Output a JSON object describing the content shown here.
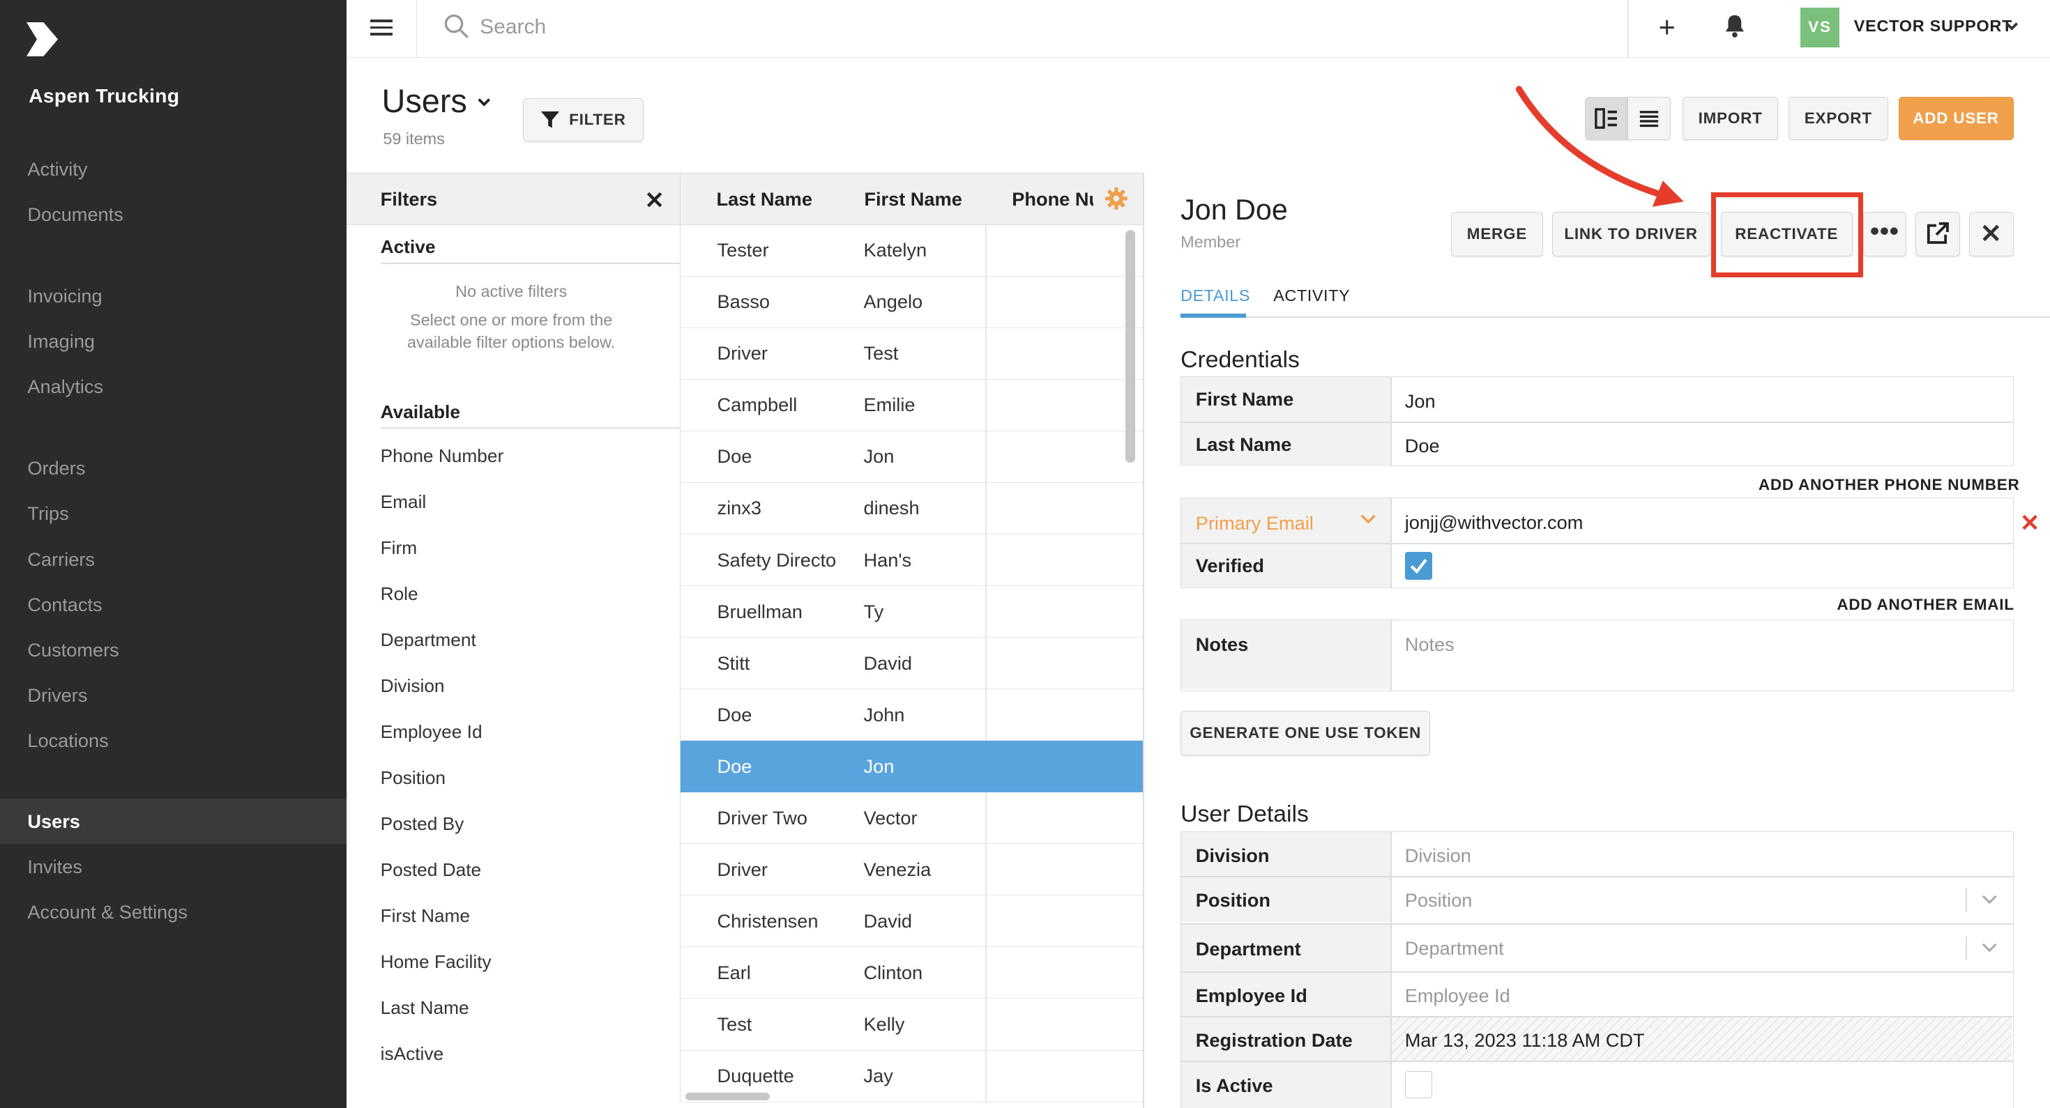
{
  "company": "Aspen Trucking",
  "nav": {
    "group1": [
      "Activity",
      "Documents"
    ],
    "group2": [
      "Invoicing",
      "Imaging",
      "Analytics"
    ],
    "group3": [
      "Orders",
      "Trips",
      "Carriers",
      "Contacts",
      "Customers",
      "Drivers",
      "Locations"
    ],
    "group4": [
      "Users",
      "Invites",
      "Account & Settings"
    ],
    "active": "Users"
  },
  "topbar": {
    "search_placeholder": "Search",
    "avatar_initials": "VS",
    "user_name": "VECTOR SUPPORT"
  },
  "header": {
    "title": "Users",
    "count": "59 items",
    "filter_label": "FILTER",
    "import_label": "IMPORT",
    "export_label": "EXPORT",
    "add_user_label": "ADD USER"
  },
  "filters": {
    "title": "Filters",
    "active_label": "Active",
    "no_filters": "No active filters",
    "hint": "Select one or more from the available filter options below.",
    "available_label": "Available",
    "options": [
      "Phone Number",
      "Email",
      "Firm",
      "Role",
      "Department",
      "Division",
      "Employee Id",
      "Position",
      "Posted By",
      "Posted Date",
      "First Name",
      "Home Facility",
      "Last Name",
      "isActive"
    ]
  },
  "list": {
    "columns": [
      "Last Name",
      "First Name",
      "Phone Nu"
    ],
    "rows": [
      [
        "Tester",
        "Katelyn"
      ],
      [
        "Basso",
        "Angelo"
      ],
      [
        "Driver",
        "Test"
      ],
      [
        "Campbell",
        "Emilie"
      ],
      [
        "Doe",
        "Jon"
      ],
      [
        "zinx3",
        "dinesh"
      ],
      [
        "Safety Directo",
        "Han's"
      ],
      [
        "Bruellman",
        "Ty"
      ],
      [
        "Stitt",
        "David"
      ],
      [
        "Doe",
        "John"
      ],
      [
        "Doe",
        "Jon"
      ],
      [
        "Driver Two",
        "Vector"
      ],
      [
        "Driver",
        "Venezia"
      ],
      [
        "Christensen",
        "David"
      ],
      [
        "Earl",
        "Clinton"
      ],
      [
        "Test",
        "Kelly"
      ],
      [
        "Duquette",
        "Jay"
      ]
    ],
    "selected_index": 10
  },
  "detail": {
    "name": "Jon Doe",
    "role": "Member",
    "merge_label": "MERGE",
    "link_label": "LINK TO DRIVER",
    "reactivate_label": "REACTIVATE",
    "more_label": "•••",
    "close_label": "✕",
    "tabs": [
      "DETAILS",
      "ACTIVITY"
    ],
    "credentials_title": "Credentials",
    "first_name_label": "First Name",
    "first_name": "Jon",
    "last_name_label": "Last Name",
    "last_name": "Doe",
    "add_phone": "ADD ANOTHER PHONE NUMBER",
    "email_type": "Primary Email",
    "email": "jonjj@withvector.com",
    "verified_label": "Verified",
    "verified": true,
    "add_email": "ADD ANOTHER EMAIL",
    "notes_label": "Notes",
    "notes_placeholder": "Notes",
    "token_label": "GENERATE ONE USE TOKEN",
    "user_details_title": "User Details",
    "division_label": "Division",
    "division_placeholder": "Division",
    "position_label": "Position",
    "position_placeholder": "Position",
    "department_label": "Department",
    "department_placeholder": "Department",
    "employee_id_label": "Employee Id",
    "employee_id_placeholder": "Employee Id",
    "registration_label": "Registration Date",
    "registration_date": "Mar 13, 2023 11:18 AM CDT",
    "is_active_label": "Is Active",
    "is_active": false
  },
  "colors": {
    "accent": "#f0a04b",
    "selection": "#5aa4de",
    "highlight": "#e43d2c",
    "link": "#4a9ad4"
  }
}
